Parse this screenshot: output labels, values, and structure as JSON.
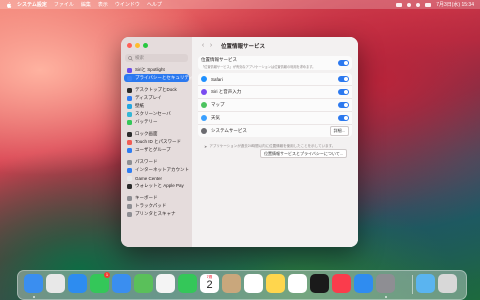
{
  "menubar": {
    "app_name": "システム設定",
    "items": [
      "ファイル",
      "編集",
      "表示",
      "ウインドウ",
      "ヘルプ"
    ],
    "clock": "7月3日(水) 15:34"
  },
  "window": {
    "title": "位置情報サービス",
    "search_placeholder": "検索",
    "sidebar": {
      "items": [
        {
          "label": "Siriと Spotlight",
          "color": "#6b4de8",
          "active": false
        },
        {
          "label": "プライバシーとセキュリティ",
          "color": "#3b82f6",
          "active": true
        },
        {
          "label": "デスクトップとDock",
          "color": "#2b2b2b",
          "active": false
        },
        {
          "label": "ディスプレイ",
          "color": "#2f7df2",
          "active": false
        },
        {
          "label": "壁紙",
          "color": "#22a6e0",
          "active": false
        },
        {
          "label": "スクリーンセーバ",
          "color": "#35b7d6",
          "active": false
        },
        {
          "label": "バッテリー",
          "color": "#34c759",
          "active": false
        },
        {
          "label": "ロック画面",
          "color": "#2b2b2b",
          "active": false
        },
        {
          "label": "Touch ID とパスワード",
          "color": "#f25c54",
          "active": false
        },
        {
          "label": "ユーザとグループ",
          "color": "#2f7df2",
          "active": false
        },
        {
          "label": "パスワード",
          "color": "#8e8e93",
          "active": false
        },
        {
          "label": "インターネットアカウント",
          "color": "#2f7df2",
          "active": false
        },
        {
          "label": "Game Center",
          "color": "#e8e8e8",
          "active": false
        },
        {
          "label": "ウォレットと Apple Pay",
          "color": "#2b2b2b",
          "active": false
        },
        {
          "label": "キーボード",
          "color": "#8e8e93",
          "active": false
        },
        {
          "label": "トラックパッド",
          "color": "#8e8e93",
          "active": false
        },
        {
          "label": "プリンタとスキャナ",
          "color": "#8e8e93",
          "active": false
        }
      ]
    },
    "main": {
      "location_services": {
        "label": "位置情報サービス",
        "subtext": "「位置情報サービス」が有効なアプリケーションは位置情報の利用を求めます。"
      },
      "apps": [
        {
          "label": "Safari",
          "icon": "safari-icon",
          "color": "#1e90ff"
        },
        {
          "label": "Siri と音声入力",
          "icon": "siri-icon",
          "color": "#7a4cf0"
        },
        {
          "label": "マップ",
          "icon": "maps-icon",
          "color": "#4cc35f"
        },
        {
          "label": "天気",
          "icon": "weather-icon",
          "color": "#3aa0ff"
        }
      ],
      "system_services": {
        "label": "システムサービス",
        "button": "詳細..."
      },
      "footnote": "アプリケーションが過去24時間以内に位置情報を使用したことを示しています。",
      "about_button": "位置情報サービスとプライバシーについて..."
    }
  },
  "dock": {
    "calendar_month": "7月",
    "calendar_day": "2",
    "messages_badge": "1",
    "apps": [
      {
        "name": "finder-icon",
        "color": "#3a8ef0"
      },
      {
        "name": "launchpad-icon",
        "color": "#e8e8e8"
      },
      {
        "name": "safari-icon",
        "color": "#2d8cf0"
      },
      {
        "name": "messages-icon",
        "color": "#34c759"
      },
      {
        "name": "mail-icon",
        "color": "#3a8ef0"
      },
      {
        "name": "maps-icon",
        "color": "#5ac05a"
      },
      {
        "name": "photos-icon",
        "color": "#f4f4f4"
      },
      {
        "name": "facetime-icon",
        "color": "#34c759"
      },
      {
        "name": "calendar-icon",
        "color": "#ffffff"
      },
      {
        "name": "contacts-icon",
        "color": "#c9a77c"
      },
      {
        "name": "reminders-icon",
        "color": "#ffffff"
      },
      {
        "name": "notes-icon",
        "color": "#ffd64d"
      },
      {
        "name": "freeform-icon",
        "color": "#ffffff"
      },
      {
        "name": "tv-icon",
        "color": "#1a1a1a"
      },
      {
        "name": "music-icon",
        "color": "#fa3c4c"
      },
      {
        "name": "app-store-icon",
        "color": "#2f8cf0"
      },
      {
        "name": "system-settings-icon",
        "color": "#8e8e93"
      },
      {
        "name": "folder-icon",
        "color": "#5ab4f0"
      },
      {
        "name": "trash-icon",
        "color": "#d8d8d8"
      }
    ]
  }
}
